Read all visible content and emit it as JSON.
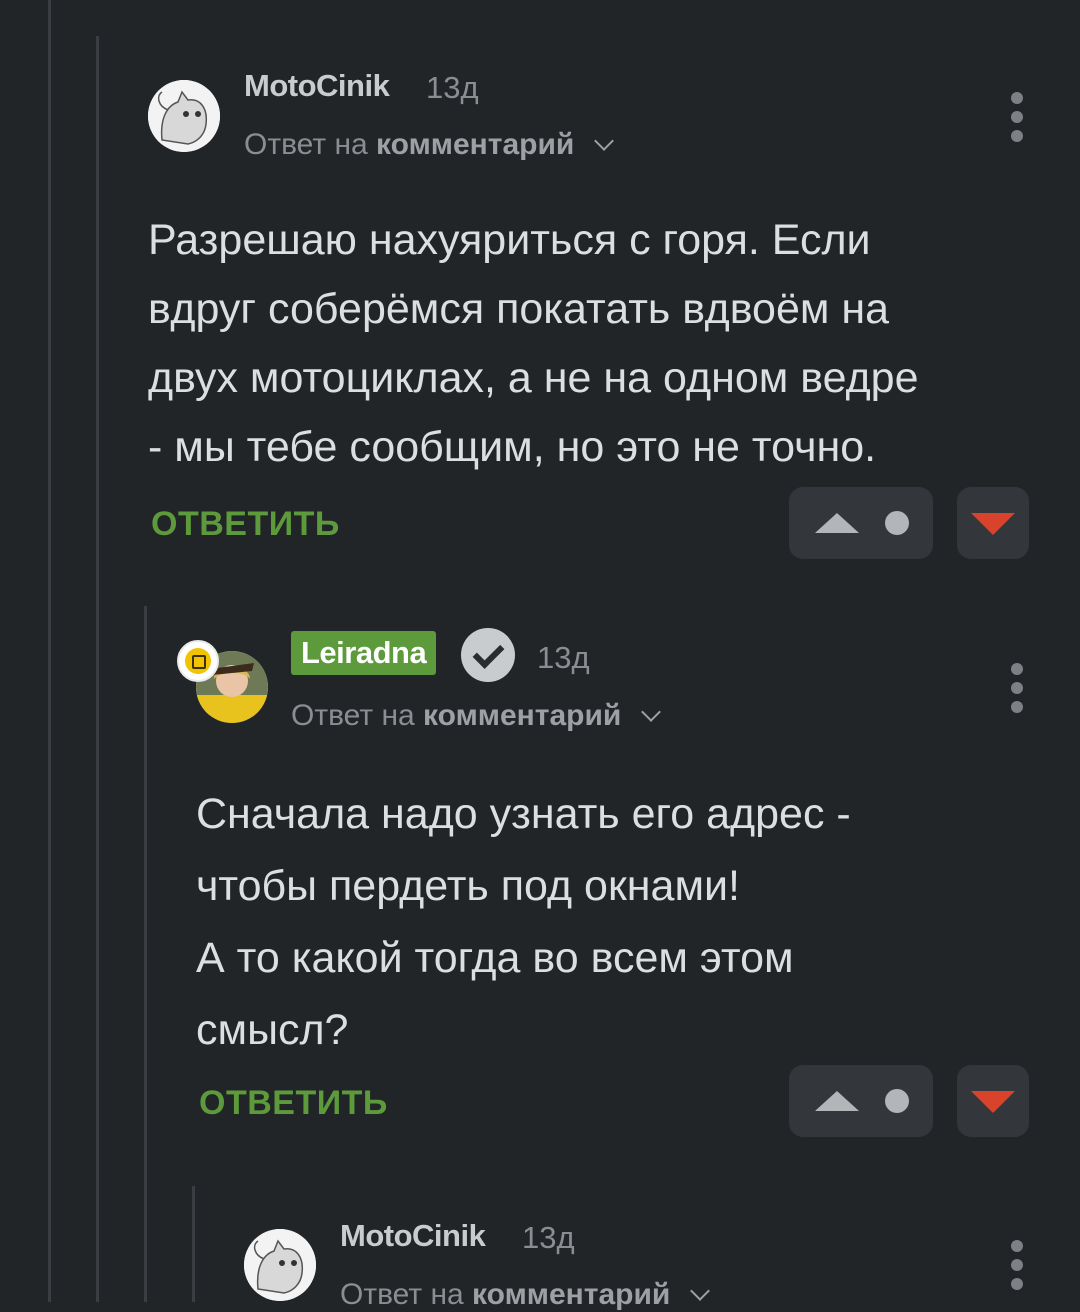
{
  "comments": [
    {
      "username": "MotoCinik",
      "time": "13д",
      "reply_prefix": "Ответ на",
      "reply_target": "комментарий",
      "text": "Разрешаю нахуяриться с горя. Если\nвдруг соберёмся покатать вдвоём на\nдвух мотоциклах, а не на одном ведре\n- мы тебе сообщим, но это не точно.",
      "reply_label": "ОТВЕТИТЬ"
    },
    {
      "username": "Leiradna",
      "time": "13д",
      "reply_prefix": "Ответ на",
      "reply_target": "комментарий",
      "text": "Сначала надо узнать его адрес -\nчтобы пердеть под окнами!\nА то какой тогда во всем этом\nсмысл?",
      "reply_label": "ОТВЕТИТЬ"
    },
    {
      "username": "MotoCinik",
      "time": "13д",
      "reply_prefix": "Ответ на",
      "reply_target": "комментарий"
    }
  ],
  "colors": {
    "background": "#222528",
    "accent_green": "#5d9a3c",
    "downvote_red": "#d9432c",
    "text": "#dcdedf",
    "muted": "#8a8e92"
  },
  "icons": [
    "kebab-menu-icon",
    "upvote-icon",
    "downvote-icon",
    "verified-check-icon",
    "chevron-down-icon",
    "badge-icon"
  ]
}
